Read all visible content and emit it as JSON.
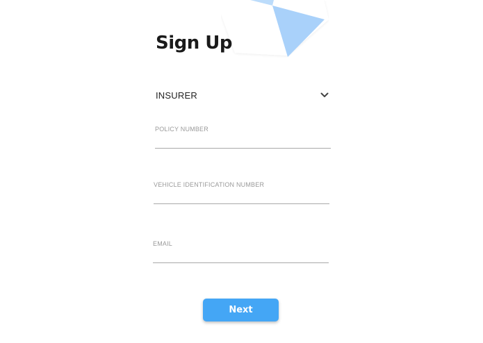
{
  "title": "Sign Up",
  "insurer_select": {
    "value": "INSURER",
    "icon": "chevron-down-icon"
  },
  "fields": {
    "policy_number": {
      "label": "POLICY NUMBER",
      "value": ""
    },
    "vin": {
      "label": "VEHICLE IDENTIFICATION NUMBER",
      "value": ""
    },
    "email": {
      "label": "EMAIL",
      "value": ""
    }
  },
  "next_button": {
    "label": "Next"
  },
  "colors": {
    "accent": "#44a6f5",
    "deco_light": "#bcdcfb",
    "deco_mid": "#a9d1fa",
    "text_dark": "#1a1a1a",
    "label_gray": "#9a9a9a",
    "underline": "#a8a8a8"
  }
}
